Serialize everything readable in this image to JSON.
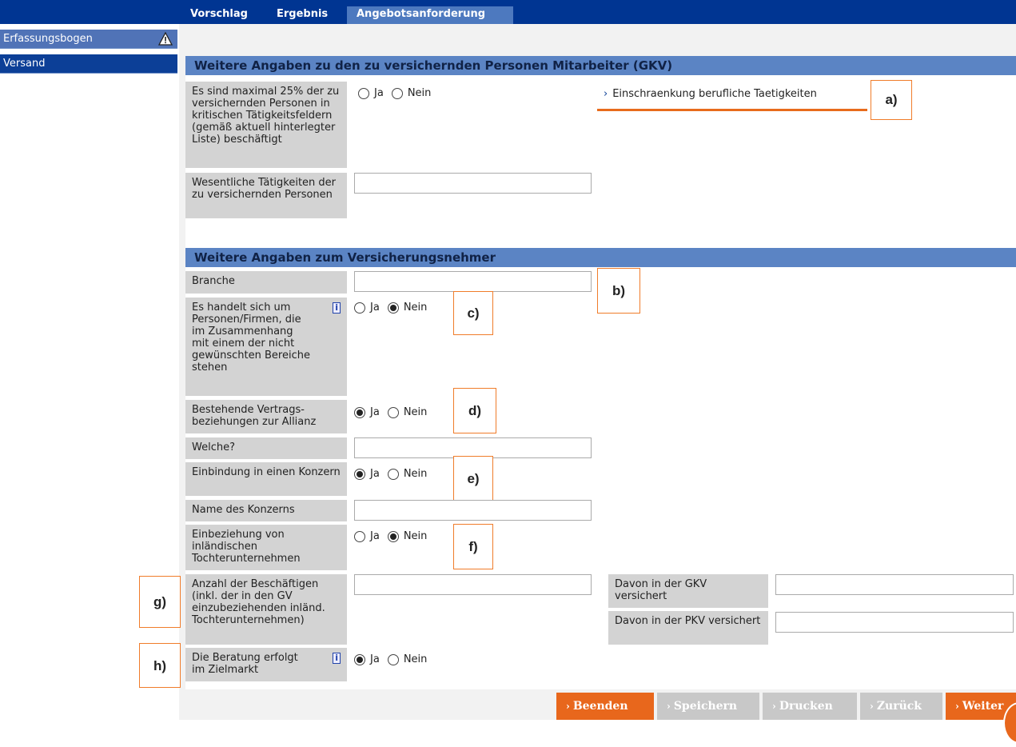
{
  "tabs": [
    {
      "label": "Vorschlag"
    },
    {
      "label": "Ergebnis"
    },
    {
      "label": "Angebotsanforderung"
    }
  ],
  "sidebar": {
    "items": [
      {
        "label": "Erfassungsbogen",
        "icon": "warning-icon"
      },
      {
        "label": "Versand"
      }
    ]
  },
  "section1": {
    "title": "Weitere Angaben zu den zu versichernden Personen Mitarbeiter (GKV)",
    "q_kritisch": {
      "label": "Es sind maximal 25% der zu versichernden Personen in kritischen Tätigkeitsfeldern (gemäß aktuell hinterlegter Liste) beschäftigt",
      "ja": "Ja",
      "nein": "Nein",
      "selected": "none"
    },
    "link": "Einschraenkung berufliche Taetigkeiten",
    "q_taetigkeiten": {
      "label": "Wesentliche Tätigkeiten der zu versichernden Personen",
      "value": ""
    }
  },
  "section2": {
    "title": "Weitere Angaben zum Versicherungsnehmer",
    "branche": {
      "label": "Branche",
      "value": ""
    },
    "q_personen": {
      "label": "Es handelt sich um Personen/Firmen, die im Zusammenhang mit einem der nicht gewünschten Bereiche stehen",
      "info": "i",
      "ja": "Ja",
      "nein": "Nein",
      "selected": "Nein"
    },
    "q_vertrag": {
      "label": "Bestehende Vertrags-beziehungen zur Allianz",
      "ja": "Ja",
      "nein": "Nein",
      "selected": "Ja"
    },
    "welche": {
      "label": "Welche?",
      "value": ""
    },
    "q_konzern": {
      "label": "Einbindung in einen Konzern",
      "ja": "Ja",
      "nein": "Nein",
      "selected": "Ja"
    },
    "konzern_name": {
      "label": "Name des Konzerns",
      "value": ""
    },
    "q_tochter": {
      "label": "Einbeziehung von inländischen Tochterunternehmen",
      "ja": "Ja",
      "nein": "Nein",
      "selected": "Nein"
    },
    "anzahl": {
      "label": "Anzahl der Beschäftigen (inkl. der in den GV einzubeziehenden inländ. Tochterunternehmen)",
      "value": ""
    },
    "gkv": {
      "label": "Davon in der GKV versichert",
      "value": ""
    },
    "pkv": {
      "label": "Davon in der PKV versichert",
      "value": ""
    },
    "q_beratung": {
      "label": "Die Beratung erfolgt im Zielmarkt",
      "info": "i",
      "ja": "Ja",
      "nein": "Nein",
      "selected": "Ja"
    }
  },
  "callouts": [
    "a)",
    "b)",
    "c)",
    "d)",
    "e)",
    "f)",
    "g)",
    "h)"
  ],
  "buttons": [
    {
      "label": "Beenden"
    },
    {
      "label": "Speichern"
    },
    {
      "label": "Drucken"
    },
    {
      "label": "Zurück"
    },
    {
      "label": "Weiter"
    }
  ],
  "colors": {
    "nav": "#003592",
    "section": "#5b84c4",
    "accent": "#e8671c"
  }
}
